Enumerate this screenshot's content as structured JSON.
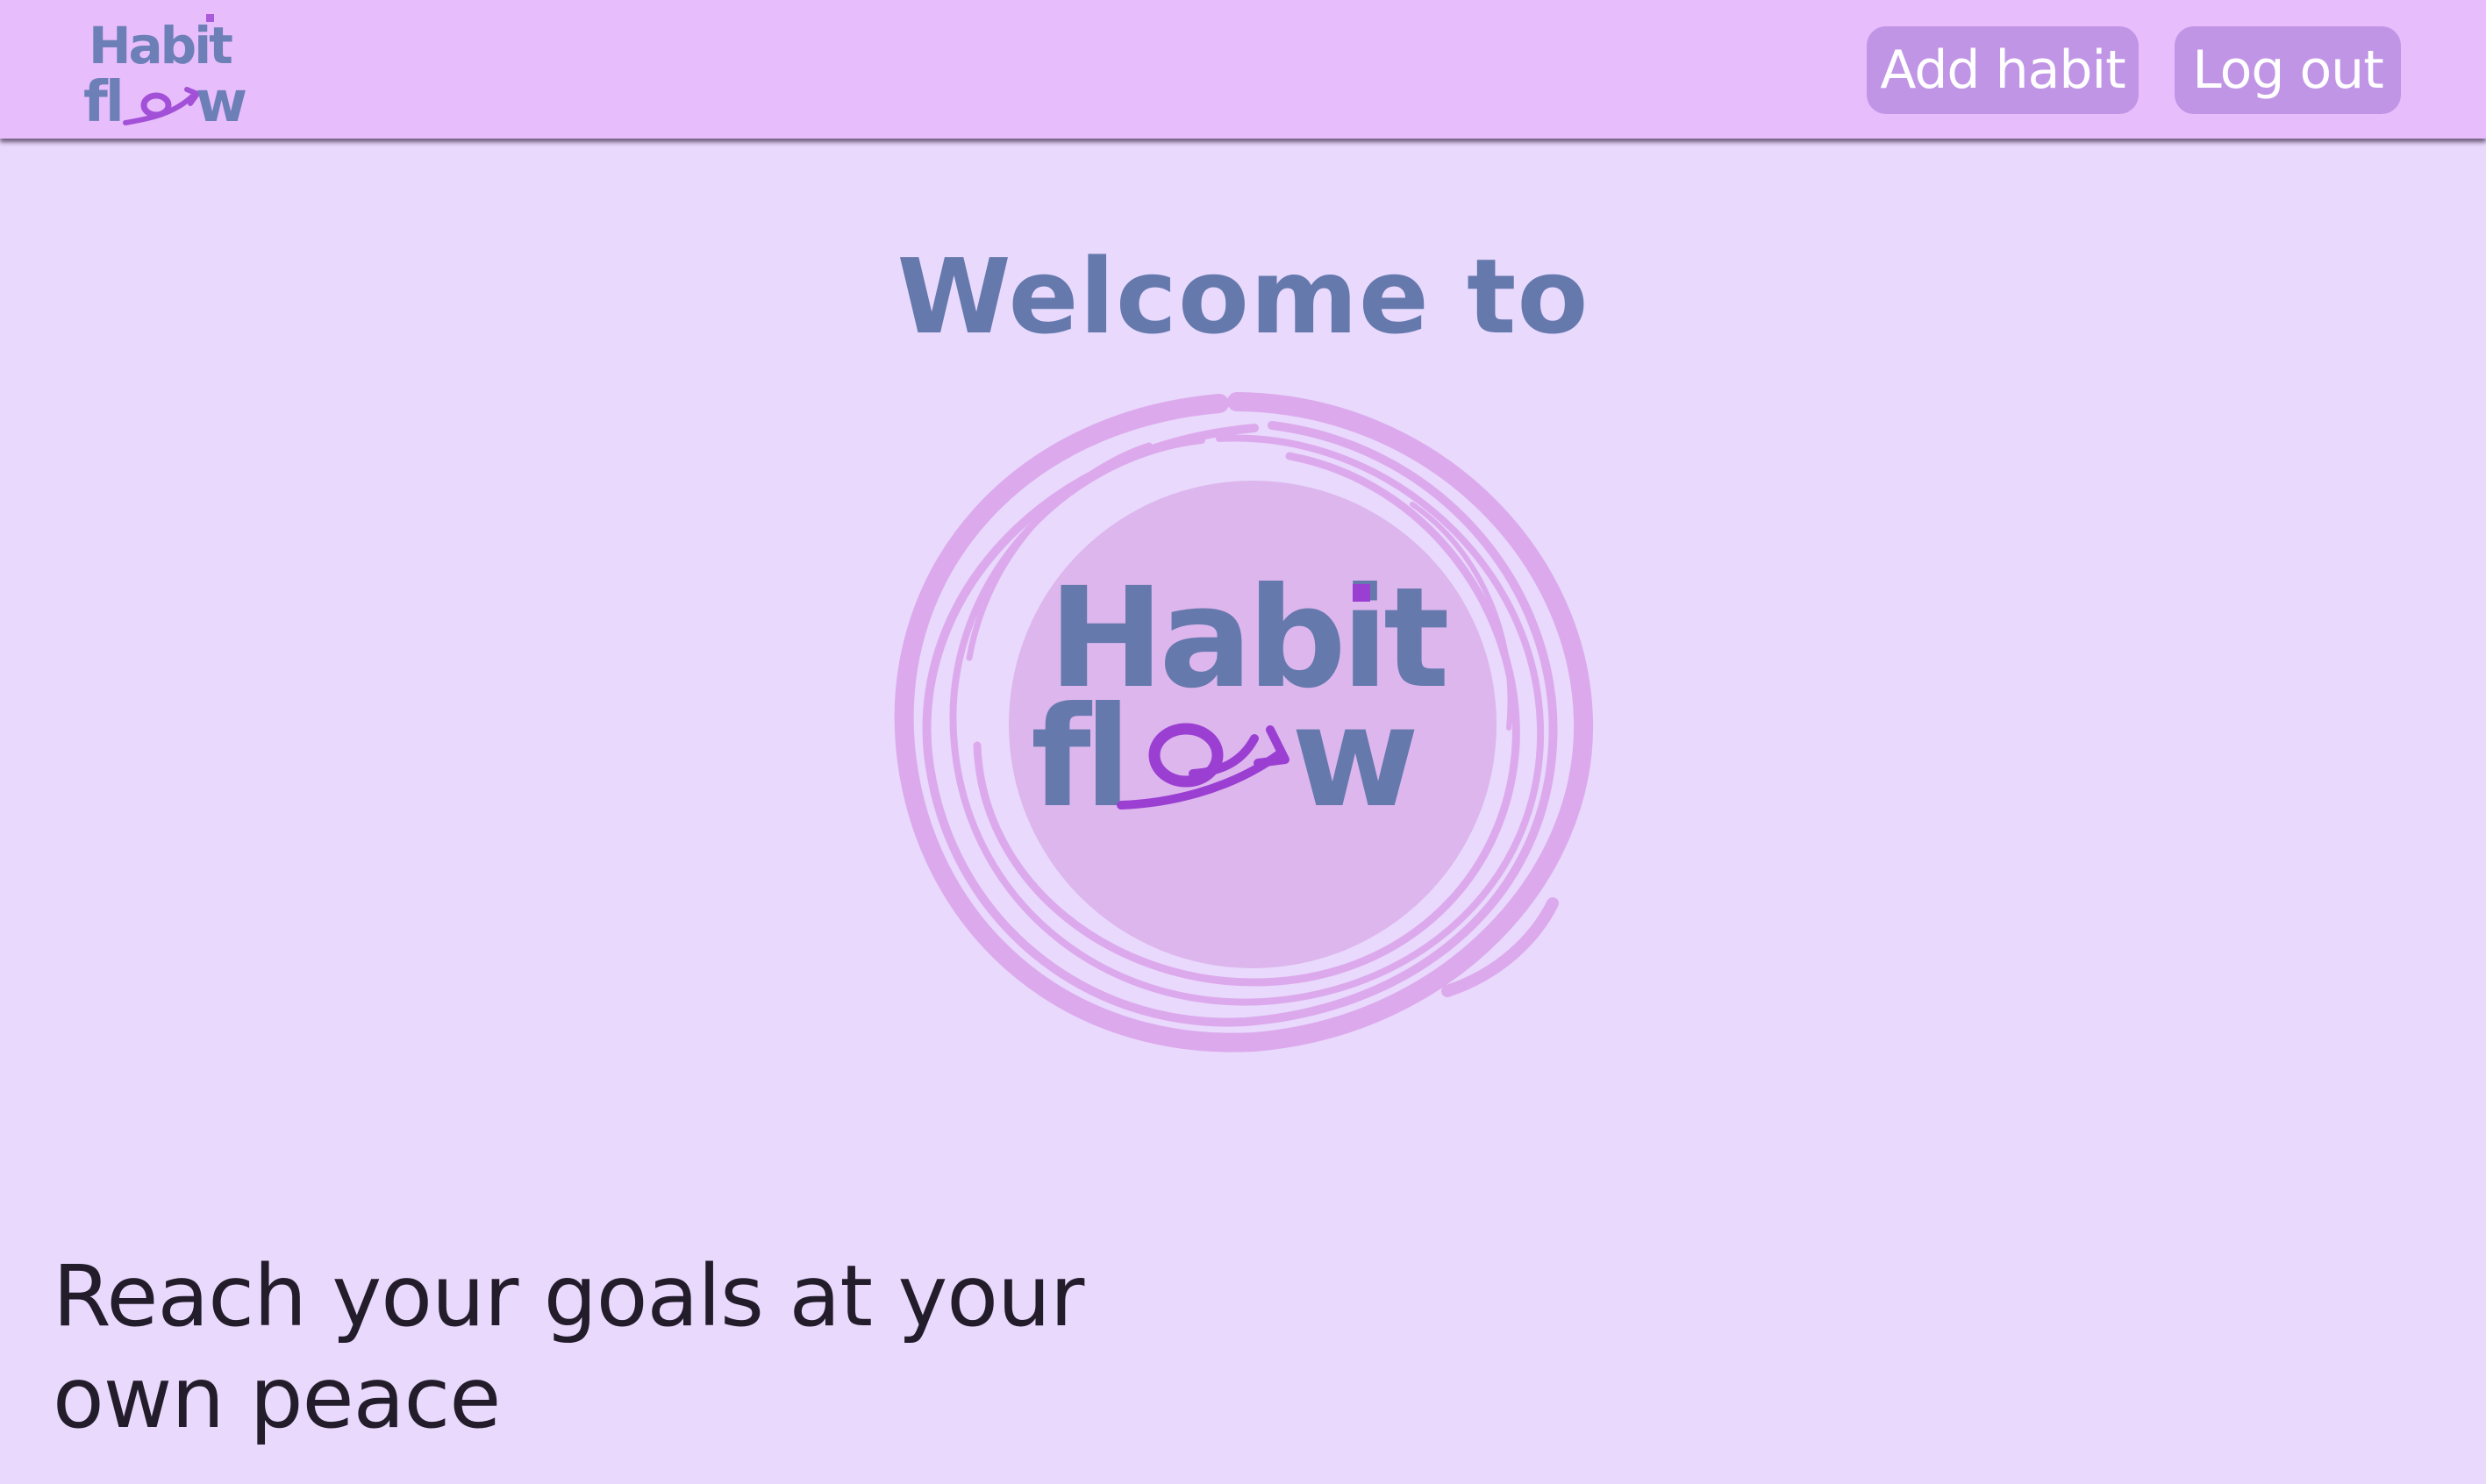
{
  "header": {
    "logo_line1": "Habit",
    "logo_line2_prefix": "fl",
    "logo_line2_suffix": "w",
    "add_habit_label": "Add habit",
    "logout_label": "Log out"
  },
  "hero": {
    "welcome_text": "Welcome to",
    "logo_line1": "Habit",
    "logo_line2_prefix": "fl",
    "logo_line2_suffix": "w",
    "logo_icon": "swirl-arrow-o-icon"
  },
  "tagline": {
    "line1": "Reach your goals at your",
    "line2": "own peace"
  },
  "colors": {
    "background": "#e9d9fd",
    "navbar": "#e7bdfb",
    "button": "#c195e6",
    "brand_blue": "#6579ad",
    "brand_purple": "#9b3fd3",
    "scribble": "#d9a9ea"
  }
}
